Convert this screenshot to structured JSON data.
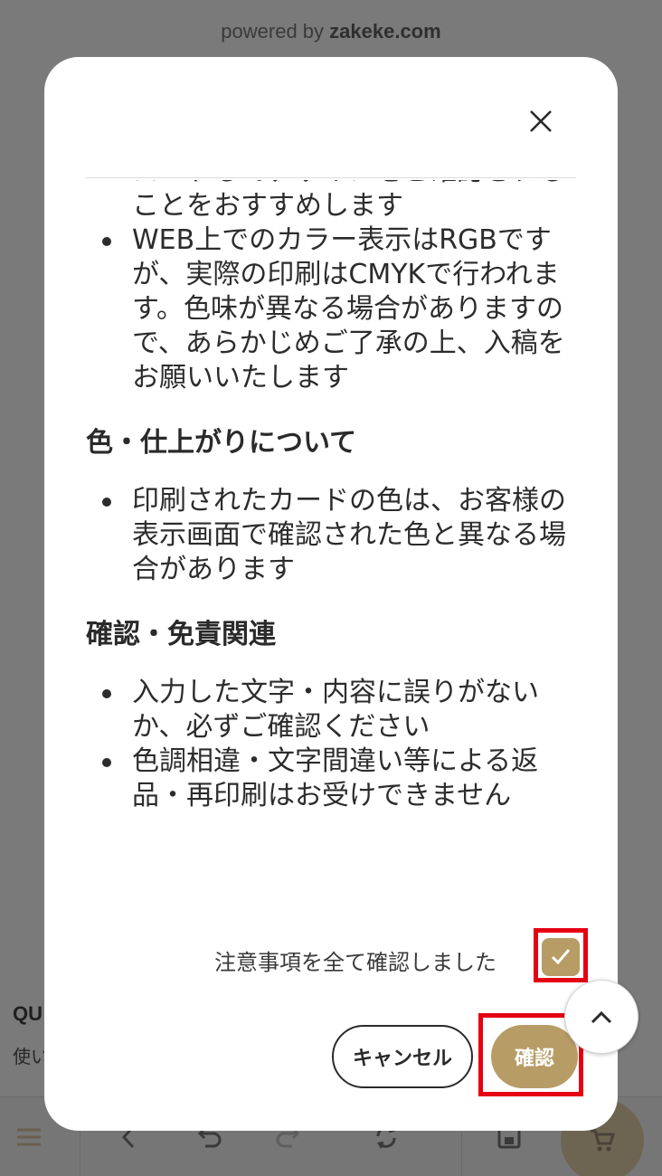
{
  "background": {
    "powered_by_prefix": "powered by ",
    "powered_by_brand": "zakeke.com",
    "left_title": "QU",
    "left_subtitle": "使い"
  },
  "modal": {
    "sections": {
      "intro_lines": [
        "ロードしてデザインをご確認される",
        "ことをおすすめします"
      ],
      "intro_bullet": [
        "WEB上でのカラー表示はRGBです",
        "が、実際の印刷はCMYKで行われま",
        "す。色味が異なる場合がありますの",
        "で、あらかじめご了承の上、入稿を",
        "お願いいたします"
      ],
      "color_heading": "色・仕上がりについて",
      "color_bullet": [
        "印刷されたカードの色は、お客様の",
        "表示画面で確認された色と異なる場",
        "合があります"
      ],
      "disclaimer_heading": "確認・免責関連",
      "disclaimer_bullet_1": [
        "入力した文字・内容に誤りがない",
        "か、必ずご確認ください"
      ],
      "disclaimer_bullet_2": [
        "色調相違・文字間違い等による返",
        "品・再印刷はお受けできません"
      ]
    },
    "confirm_label": "注意事項を全て確認しました",
    "cancel_label": "キャンセル",
    "confirm_button": "確認"
  },
  "colors": {
    "accent": "#b79c66",
    "highlight": "#e50012",
    "overlay": "#7a7a7a"
  }
}
